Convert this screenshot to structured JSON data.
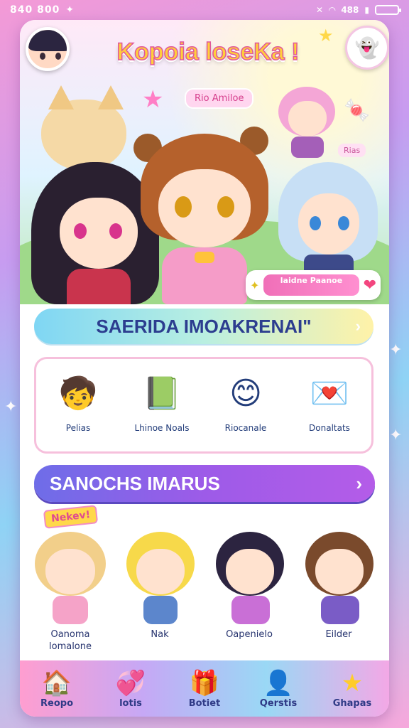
{
  "status": {
    "time": "840 800",
    "battery": "488"
  },
  "app": {
    "title": "Kopoia loseKa !"
  },
  "hero": {
    "tag": "Rio Amiloe",
    "tag2": "Rias",
    "chip_text": "laidne Paanoe"
  },
  "section1": {
    "banner": "SAERIDA IMOAKRENAI\"",
    "items": [
      {
        "label": "Pelias",
        "icon": "boy-character-icon"
      },
      {
        "label": "Lhinoe Noals",
        "icon": "green-book-icon"
      },
      {
        "label": "Riocanale",
        "icon": "smiley-face-icon"
      },
      {
        "label": "Donaltats",
        "icon": "pink-card-icon"
      }
    ]
  },
  "section2": {
    "banner": "SANOCHS IMARUS",
    "new_tag": "Nekev!",
    "characters": [
      {
        "name": "Oanoma\nlomalone"
      },
      {
        "name": "Nak"
      },
      {
        "name": "Oapenielo"
      },
      {
        "name": "Eilder"
      }
    ]
  },
  "nav": {
    "items": [
      {
        "label": "Reopo",
        "icon": "home-icon"
      },
      {
        "label": "lotis",
        "icon": "ghost-heart-icon"
      },
      {
        "label": "Botiet",
        "icon": "gift-box-icon"
      },
      {
        "label": "Qerstis",
        "icon": "profile-icon"
      },
      {
        "label": "Ghapas",
        "icon": "star-icon"
      }
    ]
  }
}
